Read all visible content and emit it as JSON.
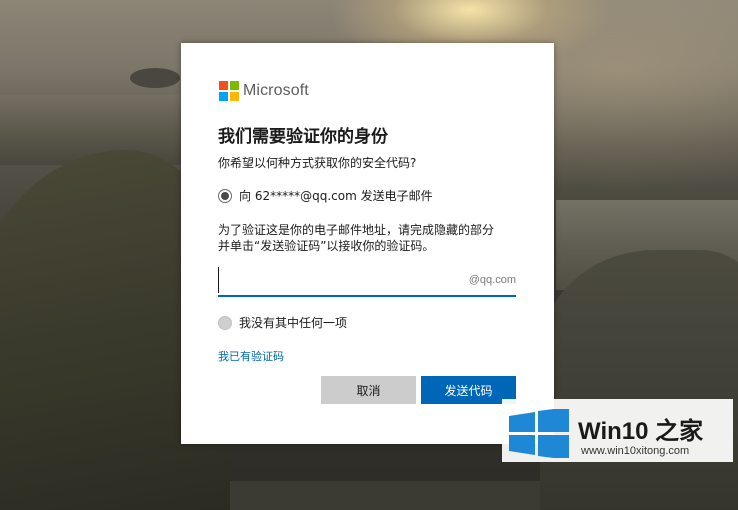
{
  "brand": {
    "name": "Microsoft",
    "logo_colors": [
      "#f25022",
      "#7fba00",
      "#00a4ef",
      "#ffb900"
    ]
  },
  "dialog": {
    "title": "我们需要验证你的身份",
    "subtitle": "你希望以何种方式获取你的安全代码?",
    "option_email": {
      "label": "向 62*****@qq.com 发送电子邮件",
      "selected": true
    },
    "description": [
      "为了验证这是你的电子邮件地址，请完成隐藏的部分",
      "并单击“发送验证码”以接收你的验证码。"
    ],
    "email_input": {
      "value": "",
      "suffix": "@qq.com"
    },
    "option_none": {
      "label": "我没有其中任何一项",
      "selected": false
    },
    "have_code_link": "我已有验证码",
    "buttons": {
      "cancel": "取消",
      "send": "发送代码"
    }
  },
  "watermark": {
    "title": "Win10 之家",
    "url": "www.win10xitong.com",
    "logo_color": "#1e88d6"
  }
}
